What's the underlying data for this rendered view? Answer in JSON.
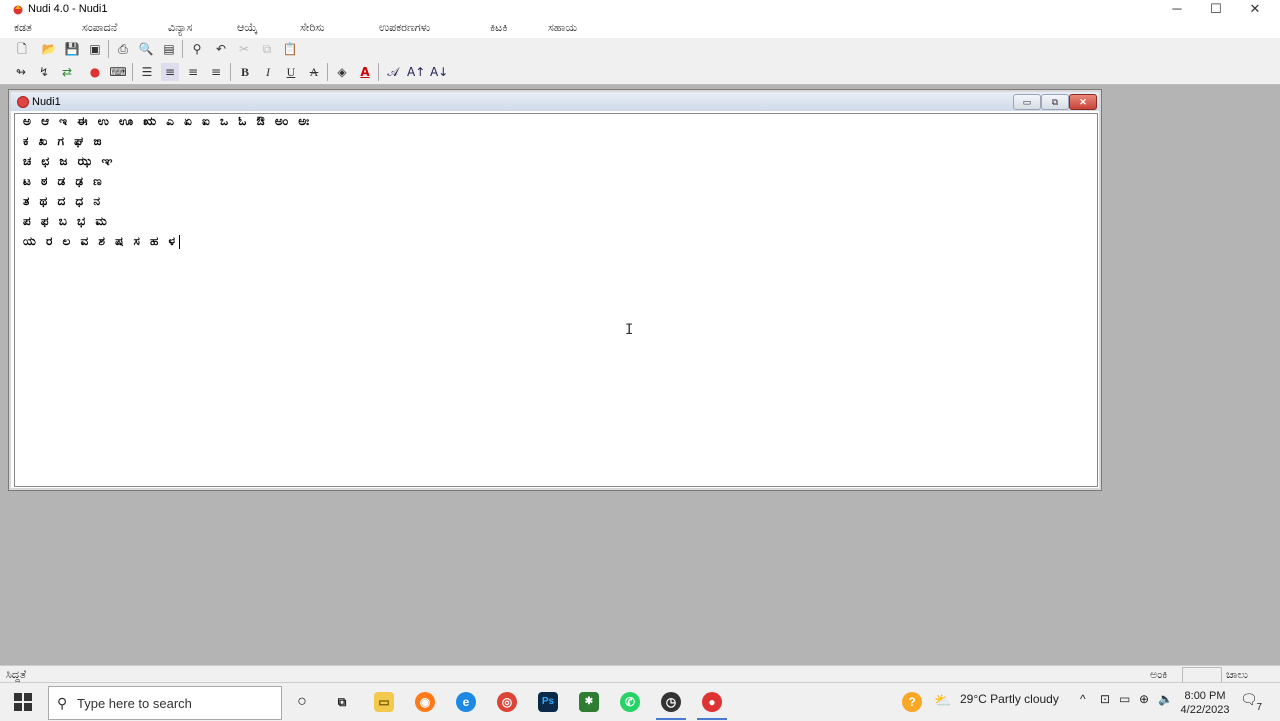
{
  "window": {
    "title": "Nudi 4.0 - Nudi1"
  },
  "menu": [
    "ಕಡತ",
    "ಸಂಪಾದನೆ",
    "ವಿನ್ಯಾಸ",
    "ಆಯ್ಕೆ",
    "ಸೇರಿಸು",
    "ಉಪಕರಣಗಳು",
    "ಕಿಟಕಿ",
    "ಸಹಾಯ"
  ],
  "document": {
    "title": "Nudi1",
    "lines": [
      "ಅ ಆ ಇ ಈ ಉ ಊ ಋ ಎ ಏ ಐ ಒ ಓ ಔ ಅಂ ಅಃ",
      "ಕ ಖ ಗ ಘ ಙ",
      "ಚ ಛ ಜ ಝ ಞ",
      "ಟ ಠ ಡ ಢ ಣ",
      "ತ ಥ ದ ಧ ನ",
      "ಪ ಫ ಬ ಭ ಮ",
      "ಯ ರ ಲ ವ ಶ ಷ ಸ ಹ ಳ"
    ]
  },
  "status": {
    "left": "ಸಿದ್ಧತೆ",
    "right1": "ಅಂಕಿ",
    "right2": "ಚಾಲು"
  },
  "taskbar": {
    "search_placeholder": "Type here to search",
    "weather": "29°C  Partly cloudy",
    "time": "8:00 PM",
    "date": "4/22/2023",
    "notifications": "7"
  }
}
